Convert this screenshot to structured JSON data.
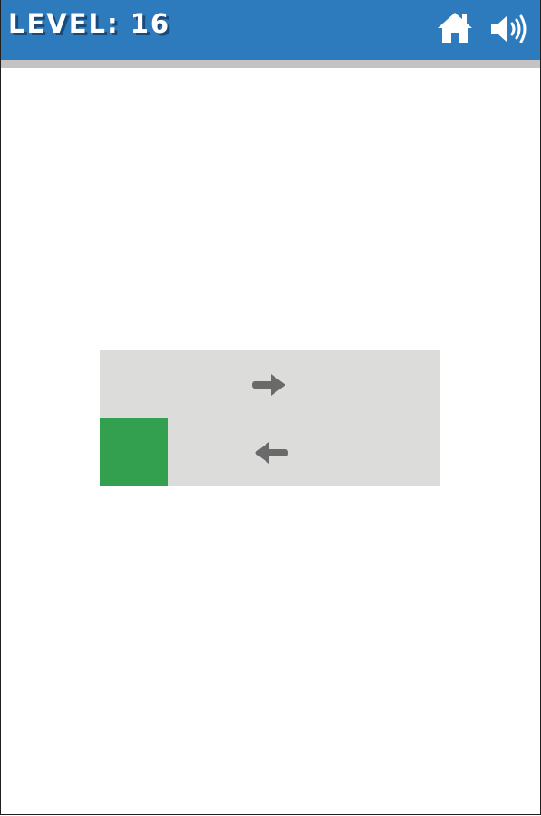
{
  "header": {
    "level_label": "LEVEL: 16",
    "home_icon": "home-icon",
    "sound_icon": "speaker-icon",
    "background_color": "#2d7bbd"
  },
  "board": {
    "rows": 2,
    "columns": 5,
    "background_color": "#dcdddb",
    "player_tile": {
      "row": 2,
      "column": 1,
      "color": "#32a04f"
    },
    "arrows": [
      {
        "row": 1,
        "column": 3,
        "direction": "right",
        "icon": "arrow-right-icon"
      },
      {
        "row": 2,
        "column": 3,
        "direction": "left",
        "icon": "arrow-left-icon"
      }
    ]
  }
}
